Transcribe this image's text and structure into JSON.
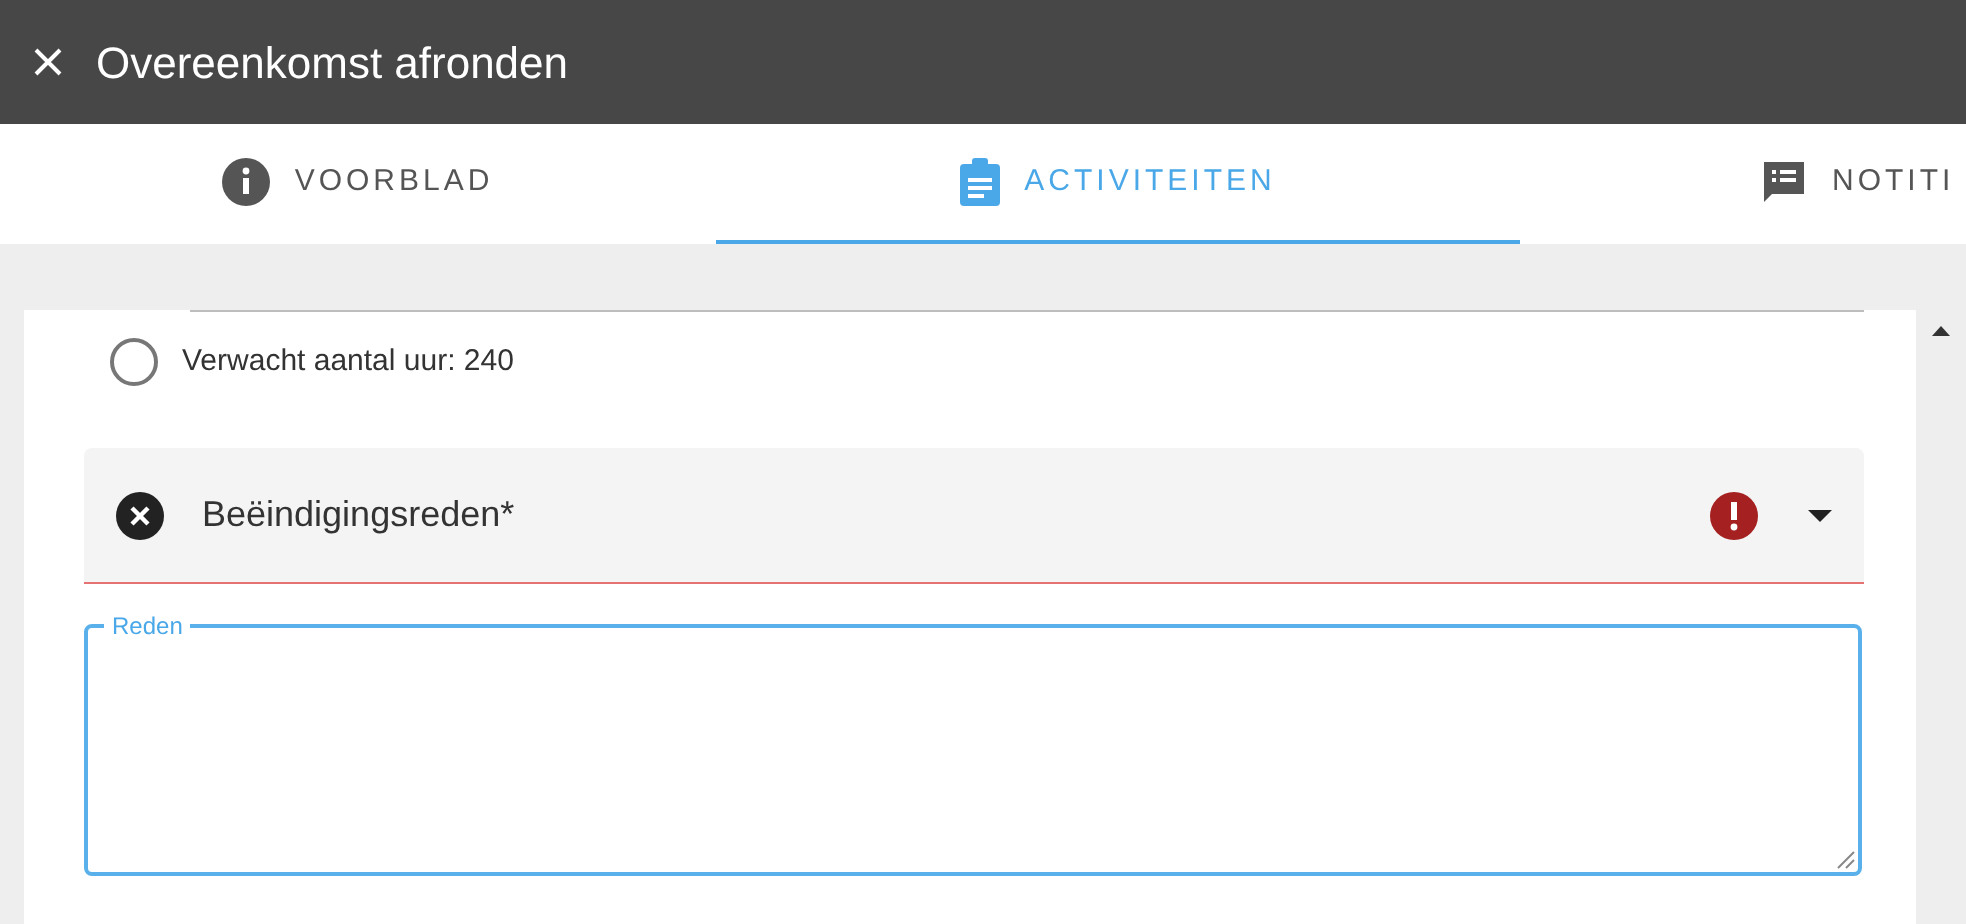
{
  "title_bar": {
    "title": "Overeenkomst afronden"
  },
  "tabs": [
    {
      "label": "VOORBLAD",
      "kind": "info",
      "selected": false
    },
    {
      "label": "ACTIVITEITEN",
      "kind": "clipboard",
      "selected": true
    },
    {
      "label": "NOTITI",
      "kind": "note",
      "selected": false
    }
  ],
  "option": {
    "label": "Verwacht aantal uur: 240",
    "checked": false
  },
  "dropdown": {
    "label": "Beëindigingsreden*",
    "error": true
  },
  "reason_field": {
    "label": "Reden"
  }
}
